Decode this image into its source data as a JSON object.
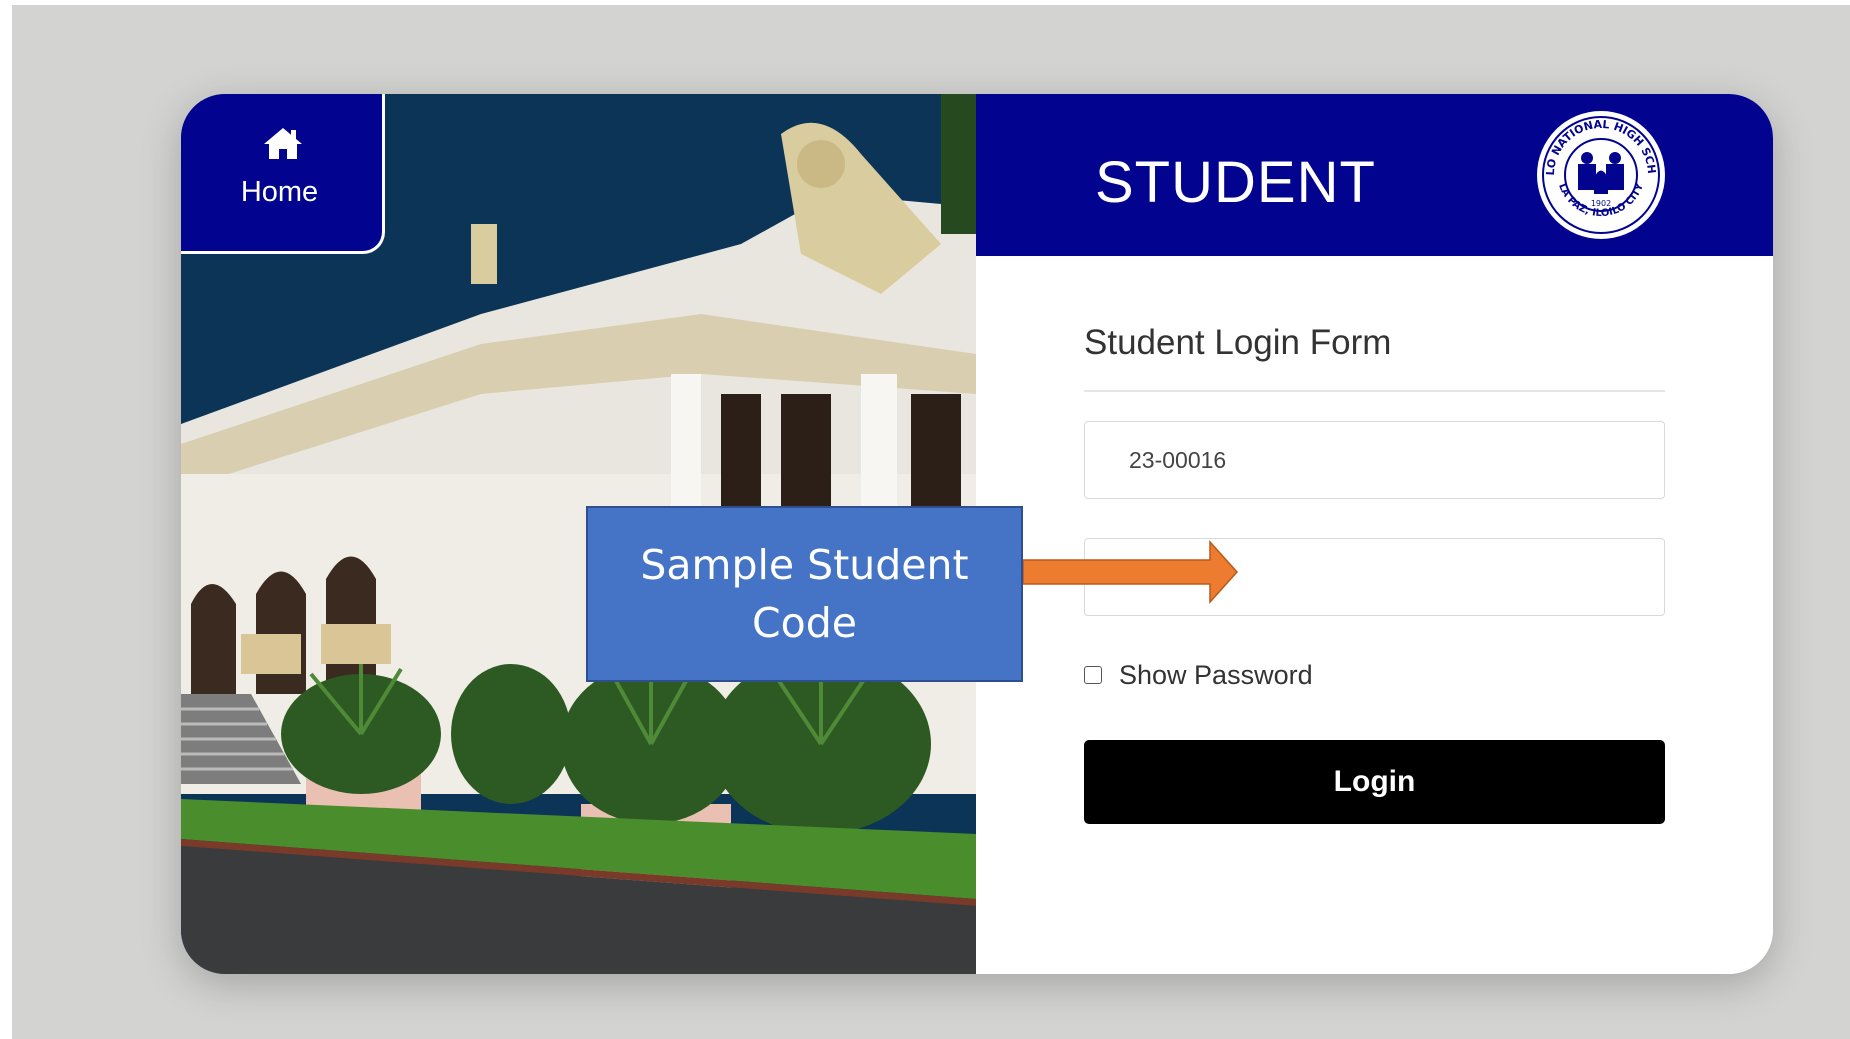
{
  "home": {
    "label": "Home",
    "icon": "home-icon"
  },
  "header": {
    "title": "STUDENT",
    "seal": "school-seal-logo"
  },
  "seal_text": {
    "top": "ILOILO NATIONAL HIGH SCHOOL",
    "bottom": "LA PAZ, ILOILO CITY",
    "year": "1902"
  },
  "form": {
    "title": "Student Login Form",
    "student_code_value": "23-00016",
    "password_value": "•••••••••",
    "show_password_label": "Show Password",
    "login_label": "Login"
  },
  "annotation": {
    "text": "Sample Student Code"
  },
  "colors": {
    "header_blue": "#02048f",
    "login_button": "#000000",
    "callout_blue": "#4574c7",
    "arrow_orange": "#ee7c30",
    "page_background": "#d3d3d1"
  }
}
